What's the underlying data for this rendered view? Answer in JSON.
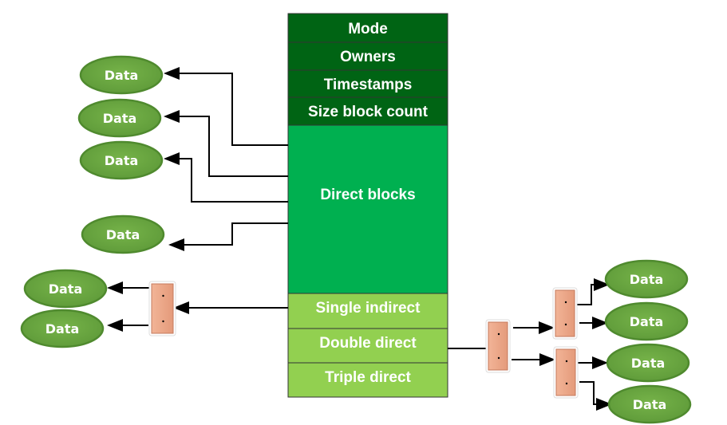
{
  "colors": {
    "header_rows": "#006414",
    "direct_blocks": "#00b050",
    "indirect_rows": "#92d050",
    "data_node": "#6aa842",
    "pointer_block": "#eeaa8c"
  },
  "inode_fields": [
    "Mode",
    "Owners",
    "Timestamps",
    "Size block count",
    "Direct blocks",
    "Single indirect",
    "Double direct",
    "Triple direct"
  ],
  "data_label": "Data",
  "data_nodes": [
    "Data",
    "Data",
    "Data",
    "Data",
    "Data",
    "Data",
    "Data",
    "Data",
    "Data",
    "Data"
  ]
}
